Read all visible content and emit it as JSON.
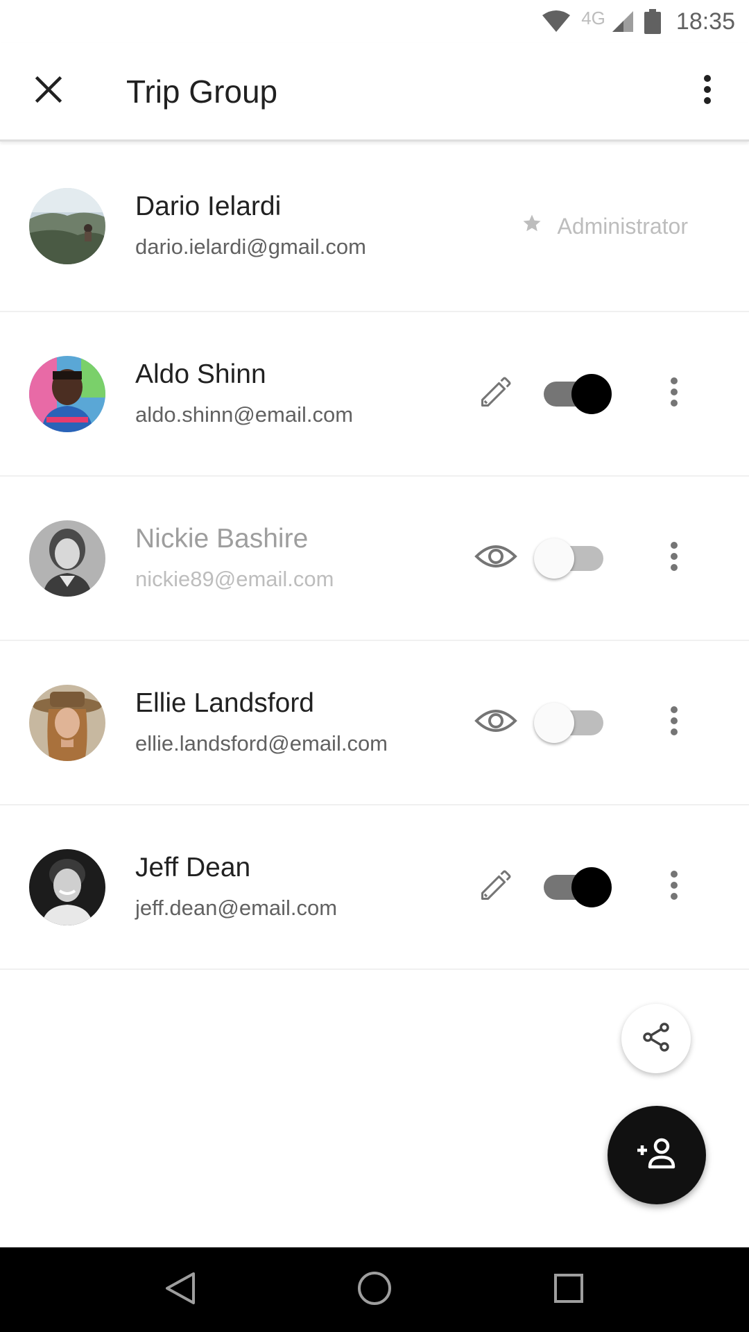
{
  "status_bar": {
    "network_label": "4G",
    "time": "18:35",
    "icons": [
      "wifi-icon",
      "signal-icon",
      "battery-icon"
    ]
  },
  "app_bar": {
    "title": "Trip Group",
    "close_icon": "close-icon",
    "menu_icon": "more-vert-icon"
  },
  "members": [
    {
      "name": "Dario Ielardi",
      "email": "dario.ielardi@gmail.com",
      "role": "Administrator",
      "role_icon": "star-icon"
    },
    {
      "name": "Aldo Shinn",
      "email": "aldo.shinn@email.com",
      "permission_icon": "pencil-icon",
      "toggle_on": true
    },
    {
      "name": "Nickie Bashire",
      "email": "nickie89@email.com",
      "permission_icon": "eye-icon",
      "toggle_on": false
    },
    {
      "name": "Ellie Landsford",
      "email": "ellie.landsford@email.com",
      "permission_icon": "eye-icon",
      "toggle_on": false
    },
    {
      "name": "Jeff Dean",
      "email": "jeff.dean@email.com",
      "permission_icon": "pencil-icon",
      "toggle_on": true
    }
  ],
  "fabs": {
    "share_icon": "share-icon",
    "add_icon": "add-person-icon"
  },
  "nav_bar": {
    "icons": [
      "back-icon",
      "home-icon",
      "recents-icon"
    ]
  },
  "colors": {
    "accent": "#000000",
    "toggle_track_on": "#757575",
    "toggle_track_off": "#bdbdbd",
    "text_primary": "#212121",
    "text_secondary": "#616161",
    "text_muted": "#9e9e9e"
  }
}
